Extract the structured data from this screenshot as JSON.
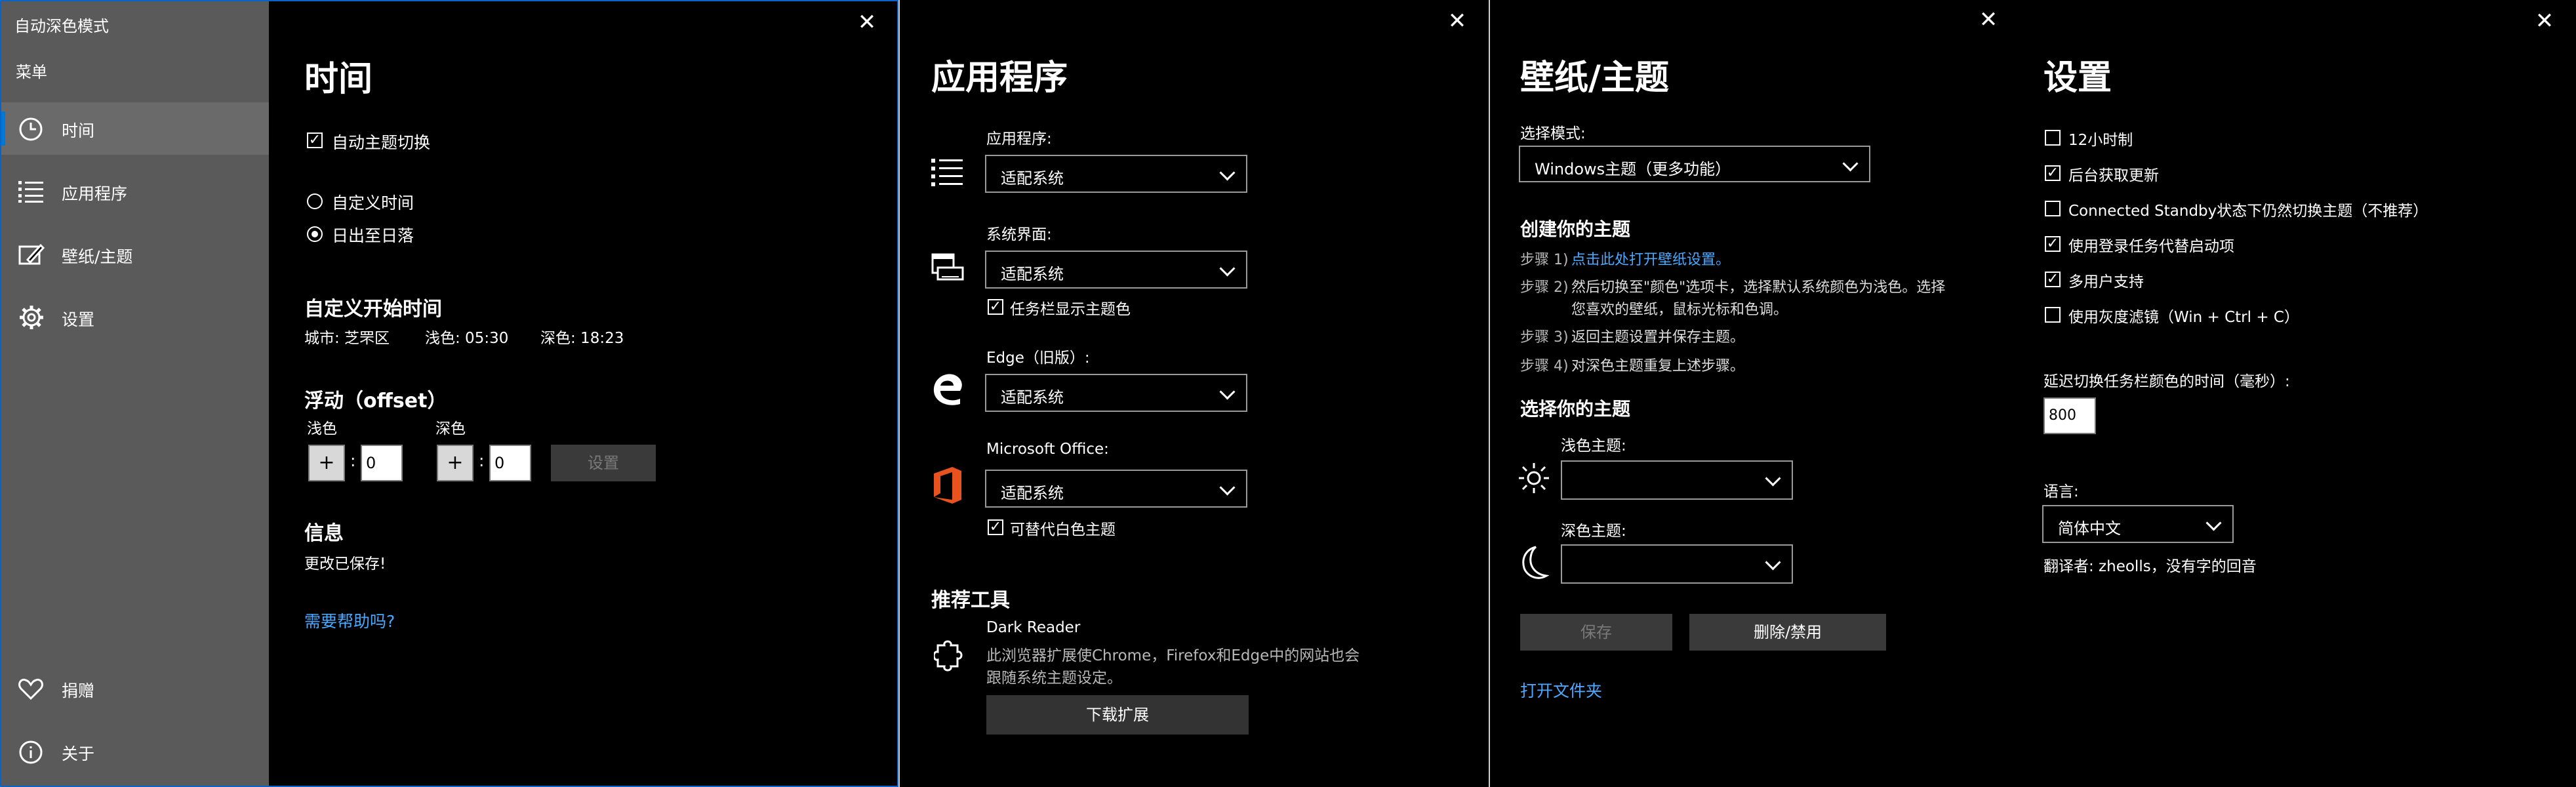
{
  "window1": {
    "title": "自动深色模式",
    "menu_label": "菜单",
    "nav": {
      "time": "时间",
      "apps": "应用程序",
      "wallpaper": "壁纸/主题",
      "settings": "设置",
      "donate": "捐赠",
      "about": "关于"
    },
    "heading": "时间",
    "auto_switch": "自动主题切换",
    "custom_time": "自定义时间",
    "sunset_sunrise": "日出至日落",
    "custom_start_heading": "自定义开始时间",
    "city": "城市: 芝罘区",
    "light_time": "浅色: 05:30",
    "dark_time": "深色: 18:23",
    "offset_heading": "浮动（offset）",
    "light_label": "浅色",
    "dark_label": "深色",
    "plus": "+",
    "colon": ":",
    "light_offset": "0",
    "dark_offset": "0",
    "set_button": "设置",
    "info_heading": "信息",
    "info_text": "更改已保存!",
    "help_link": "需要帮助吗?"
  },
  "window2": {
    "heading": "应用程序",
    "apps_label": "应用程序:",
    "apps_value": "适配系统",
    "system_label": "系统界面:",
    "system_value": "适配系统",
    "taskbar_accent": "任务栏显示主题色",
    "edge_label": "Edge（旧版）:",
    "edge_value": "适配系统",
    "office_label": "Microsoft Office:",
    "office_value": "适配系统",
    "office_white": "可替代白色主题",
    "tools_heading": "推荐工具",
    "dark_reader_title": "Dark Reader",
    "dark_reader_desc_1": "此浏览器扩展使Chrome，Firefox和Edge中的网站也会",
    "dark_reader_desc_2": "跟随系统主题设定。",
    "download_button": "下载扩展"
  },
  "window3": {
    "heading": "壁纸/主题",
    "select_mode_label": "选择模式:",
    "mode_value": "Windows主题（更多功能）",
    "create_heading": "创建你的主题",
    "step1_prefix": "步骤 1)",
    "step1_link": "点击此处打开壁纸设置。",
    "step2_prefix": "步骤 2)",
    "step2_text_1": "然后切换至\"颜色\"选项卡，选择默认系统颜色为浅色。选择",
    "step2_text_2": "您喜欢的壁纸，鼠标光标和色调。",
    "step3_prefix": "步骤 3)",
    "step3_text": "返回主题设置并保存主题。",
    "step4_prefix": "步骤 4)",
    "step4_text": "对深色主题重复上述步骤。",
    "choose_heading": "选择你的主题",
    "light_theme_label": "浅色主题:",
    "light_theme_value": "",
    "dark_theme_label": "深色主题:",
    "dark_theme_value": "",
    "save_button": "保存",
    "delete_button": "删除/禁用",
    "open_folder_link": "打开文件夹"
  },
  "window4": {
    "heading": "设置",
    "opt_12h": "12小时制",
    "opt_bg_update": "后台获取更新",
    "opt_standby": "Connected Standby状态下仍然切换主题（不推荐）",
    "opt_login_task": "使用登录任务代替启动项",
    "opt_multiuser": "多用户支持",
    "opt_grayscale": "使用灰度滤镜（Win + Ctrl + C）",
    "delay_label": "延迟切换任务栏颜色的时间（毫秒）:",
    "delay_value": "800",
    "language_label": "语言:",
    "language_value": "简体中文",
    "translator": "翻译者: zheolls，没有字的回音"
  },
  "checked": {
    "auto_switch": true,
    "taskbar_accent": true,
    "office_white": true,
    "opt_12h": false,
    "opt_bg_update": true,
    "opt_standby": false,
    "opt_login_task": true,
    "opt_multiuser": true,
    "opt_grayscale": false
  },
  "colors": {
    "sidebar_bg": "#5a5a5a",
    "selected_accent": "#0078d7",
    "link": "#4aa8ff",
    "window_border": "#0a64c8"
  },
  "icons": {
    "close": "close-icon",
    "clock": "clock-icon",
    "list": "list-icon",
    "paint": "paint-icon",
    "gear": "gear-icon",
    "heart": "heart-icon",
    "info": "info-icon",
    "apps": "apps-list-icon",
    "system": "system-ui-icon",
    "edge": "edge-icon",
    "office": "office-icon",
    "puzzle": "puzzle-icon",
    "sun": "sun-icon",
    "moon": "moon-icon"
  }
}
